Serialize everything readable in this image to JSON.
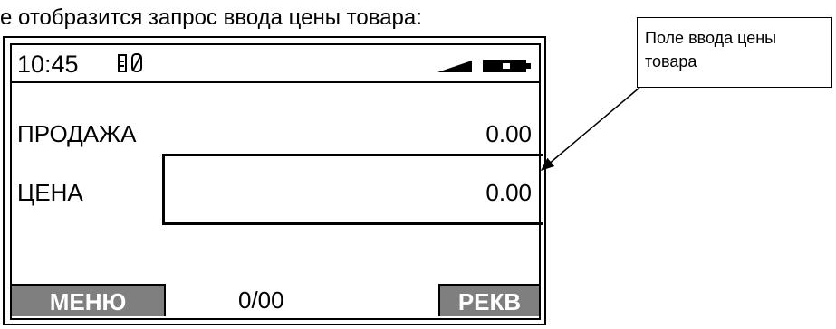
{
  "intro_text": "е отобразится запрос ввода цены товара:",
  "status": {
    "time": "10:45",
    "document_icon": "document-icon",
    "zero_icon": "slashed-zero-icon",
    "signal_icon": "signal-strength-icon",
    "battery_icon": "battery-icon"
  },
  "rows": {
    "sale_label": "ПРОДАЖА",
    "sale_value": "0.00",
    "price_label": "ЦЕНА",
    "price_value": "0.00"
  },
  "softkeys": {
    "left": "МЕНЮ",
    "right": "РЕКВ"
  },
  "counter": "0/00",
  "callout": {
    "text": "Поле ввода цены товара"
  },
  "colors": {
    "softkey_background": "#7f7f7f",
    "softkey_text": "#ffffff",
    "border": "#000000",
    "background": "#ffffff"
  }
}
